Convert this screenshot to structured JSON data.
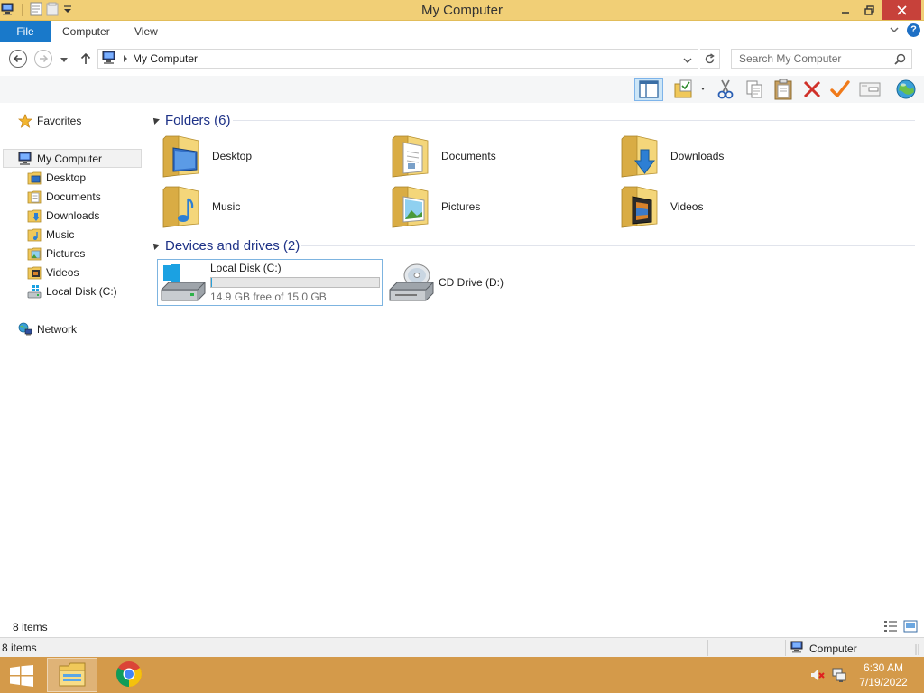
{
  "window": {
    "title": "My Computer"
  },
  "ribbon": {
    "file_tab": "File",
    "tabs": [
      "Computer",
      "View"
    ]
  },
  "address": {
    "breadcrumb": "My Computer",
    "search_placeholder": "Search My Computer"
  },
  "toolbar": {
    "icons": [
      "preview-pane-icon",
      "new-folder-icon",
      "cut-icon",
      "copy-icon",
      "paste-icon",
      "delete-icon",
      "rename-icon",
      "properties-icon",
      "web-icon"
    ]
  },
  "navigation": {
    "favorites": "Favorites",
    "my_computer": "My Computer",
    "children": [
      "Desktop",
      "Documents",
      "Downloads",
      "Music",
      "Pictures",
      "Videos",
      "Local Disk (C:)"
    ],
    "network": "Network"
  },
  "content": {
    "folders_header": "Folders (6)",
    "folders": [
      {
        "name": "Desktop",
        "icon": "desktop-folder-icon"
      },
      {
        "name": "Documents",
        "icon": "documents-folder-icon"
      },
      {
        "name": "Downloads",
        "icon": "downloads-folder-icon"
      },
      {
        "name": "Music",
        "icon": "music-folder-icon"
      },
      {
        "name": "Pictures",
        "icon": "pictures-folder-icon"
      },
      {
        "name": "Videos",
        "icon": "videos-folder-icon"
      }
    ],
    "drives_header": "Devices and drives (2)",
    "drives": [
      {
        "name": "Local Disk (C:)",
        "free_text": "14.9 GB free of 15.0 GB",
        "used_fraction": 0.007
      },
      {
        "name": "CD Drive (D:)"
      }
    ]
  },
  "status": {
    "inner_count": "8 items",
    "outer_count": "8 items",
    "zone": "Computer"
  },
  "taskbar": {
    "time": "6:30 AM",
    "date": "7/19/2022"
  },
  "colors": {
    "title_bar": "#f1cf76",
    "file_tab": "#1979ca",
    "group_header": "#1e3287",
    "taskbar": "#d49a4a",
    "close_button": "#c7413a",
    "selection_border": "#7db4e0"
  }
}
